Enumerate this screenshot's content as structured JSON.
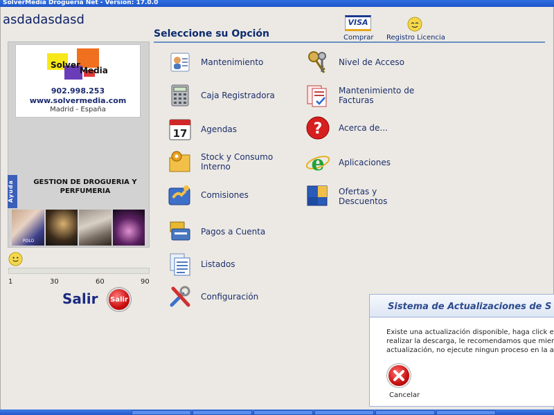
{
  "window": {
    "title": "SolverMedia Droguería Net     -     Version: 17.0.0"
  },
  "company_name": "asdadasdasd",
  "logo": {
    "text_left": "Solver",
    "text_right": "Media",
    "phone": "902.998.253",
    "website": "www.solvermedia.com",
    "city": "Madrid - España",
    "colors": {
      "orange": "#F07020",
      "yellow": "#F7E81A",
      "purple": "#6A3DB8",
      "red": "#E13A3A"
    }
  },
  "side_tab": {
    "label": "Ayuda"
  },
  "product_title": "GESTION DE DROGUERIA Y PERFUMERIA",
  "photo_strip": {
    "brand_label": "POLO"
  },
  "progress": {
    "ticks": [
      "1",
      "30",
      "60",
      "90"
    ],
    "fraction": 0.0
  },
  "salir": {
    "text": "Salir",
    "button_label": "Salir"
  },
  "header": {
    "options_title": "Seleccione su Opción",
    "visa_label": "VISA",
    "comprar": "Comprar",
    "registro": "Registro Licencia"
  },
  "menu_left": [
    {
      "label": "Mantenimiento",
      "icon": "user-card-icon"
    },
    {
      "label": "Caja Registradora",
      "icon": "calculator-icon"
    },
    {
      "label": "Agendas",
      "icon": "calendar-icon",
      "calendar_day": "17"
    },
    {
      "label": "Stock y Consumo Interno",
      "icon": "folder-gear-icon"
    },
    {
      "label": "Comisiones",
      "icon": "handshake-icon"
    },
    {
      "label": "Pagos a Cuenta",
      "icon": "payment-icon"
    },
    {
      "label": "Listados",
      "icon": "documents-list-icon"
    },
    {
      "label": "Configuración",
      "icon": "tools-icon"
    }
  ],
  "menu_right": [
    {
      "label": "Nivel de Acceso",
      "icon": "keys-icon"
    },
    {
      "label": "Mantenimiento de Facturas",
      "icon": "invoices-icon"
    },
    {
      "label": "Acerca de...",
      "icon": "question-icon"
    },
    {
      "label": "Aplicaciones",
      "icon": "ie-globe-icon"
    },
    {
      "label": "Ofertas y Descuentos",
      "icon": "offers-box-icon"
    }
  ],
  "update_dialog": {
    "title": "Sistema de Actualizaciones de S",
    "lines": [
      "Existe una actualización disponible, haga click en ac",
      "realizar la descarga, le recomendamos que mientras",
      "actualización, no ejecute ningun proceso en la aplica"
    ],
    "cancel_label": "Cancelar"
  }
}
